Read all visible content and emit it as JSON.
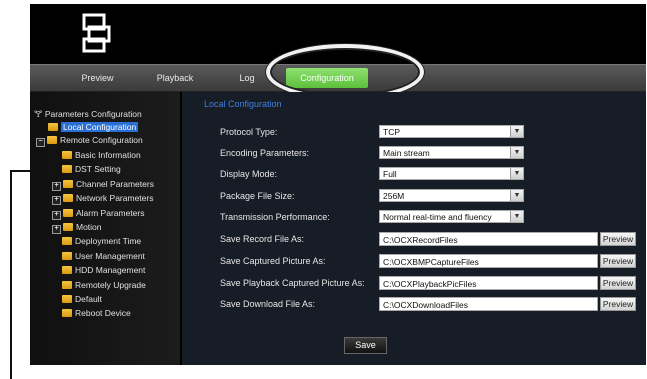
{
  "nav": {
    "tabs": [
      {
        "label": "Preview"
      },
      {
        "label": "Playback"
      },
      {
        "label": "Log"
      },
      {
        "label": "Configuration",
        "active": true
      }
    ]
  },
  "tree": {
    "root": "Parameters Configuration",
    "local": "Local Configuration",
    "remote": "Remote Configuration",
    "items": [
      "Basic Information",
      "DST Setting",
      "Channel Parameters",
      "Network Parameters",
      "Alarm Parameters",
      "Motion",
      "Deployment Time",
      "User Management",
      "HDD Management",
      "Remotely Upgrade",
      "Default",
      "Reboot Device"
    ]
  },
  "main": {
    "title": "Local Configuration",
    "fields": [
      {
        "label": "Protocol Type:",
        "value": "TCP"
      },
      {
        "label": "Encoding Parameters:",
        "value": "Main stream"
      },
      {
        "label": "Display Mode:",
        "value": "Full"
      },
      {
        "label": "Package File Size:",
        "value": "256M"
      },
      {
        "label": "Transmission Performance:",
        "value": "Normal real-time and fluency"
      }
    ],
    "paths": [
      {
        "label": "Save Record File As:",
        "value": "C:\\OCXRecordFiles",
        "button": "Preview"
      },
      {
        "label": "Save Captured Picture As:",
        "value": "C:\\OCXBMPCaptureFiles",
        "button": "Preview"
      },
      {
        "label": "Save Playback Captured Picture As:",
        "value": "C:\\OCXPlaybackPicFiles",
        "button": "Preview"
      },
      {
        "label": "Save Download File As:",
        "value": "C:\\OCXDownloadFiles",
        "button": "Preview"
      }
    ],
    "save_label": "Save"
  },
  "colors": {
    "accent_tab": "#6fd04c",
    "selection": "#2a6fd6",
    "section_title": "#3f7fe0"
  }
}
